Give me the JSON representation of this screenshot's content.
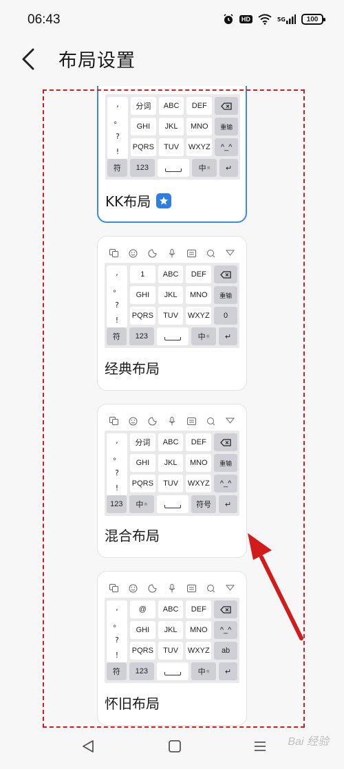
{
  "status": {
    "time": "06:43",
    "network": "5G",
    "battery": "100"
  },
  "header": {
    "title": "布局设置"
  },
  "layouts": [
    {
      "name": "KK布局",
      "selected": true,
      "rows": [
        [
          "分词",
          "ABC",
          "DEF",
          "⌫"
        ],
        [
          "GHI",
          "JKL",
          "MNO",
          "重输"
        ],
        [
          "PQRS",
          "TUV",
          "WXYZ",
          "^_^"
        ],
        [
          "符",
          "123",
          "",
          "中",
          "↵"
        ]
      ],
      "punct": [
        ",",
        "。",
        "?",
        "!"
      ]
    },
    {
      "name": "经典布局",
      "selected": false,
      "rows": [
        [
          "1",
          "ABC",
          "DEF",
          "⌫"
        ],
        [
          "GHI",
          "JKL",
          "MNO",
          "重输"
        ],
        [
          "PQRS",
          "TUV",
          "WXYZ",
          "0"
        ],
        [
          "符",
          "123",
          "",
          "中",
          "↵"
        ]
      ],
      "punct": [
        ",",
        "。",
        "?",
        "!"
      ]
    },
    {
      "name": "混合布局",
      "selected": false,
      "rows": [
        [
          "分词",
          "ABC",
          "DEF",
          "⌫"
        ],
        [
          "GHI",
          "JKL",
          "MNO",
          "重输"
        ],
        [
          "PQRS",
          "TUV",
          "WXYZ",
          "^_^"
        ],
        [
          "123",
          "中",
          "",
          "符号",
          "↵"
        ]
      ],
      "punct": [
        ",",
        "。",
        "?",
        "!"
      ]
    },
    {
      "name": "怀旧布局",
      "selected": false,
      "rows": [
        [
          "@",
          "ABC",
          "DEF",
          "⌫"
        ],
        [
          "GHI",
          "JKL",
          "MNO",
          "^_^"
        ],
        [
          "PQRS",
          "TUV",
          "WXYZ",
          "ab"
        ],
        [
          "符",
          "123",
          "",
          "中",
          "↵"
        ]
      ],
      "punct": [
        ",",
        "。",
        "?",
        "!"
      ]
    }
  ],
  "icons": {
    "back": "chevron-left-icon",
    "toolbar": [
      "translate-icon",
      "emoji-icon",
      "theme-icon",
      "mic-icon",
      "keyboard-icon",
      "search-icon",
      "collapse-icon"
    ],
    "nav": [
      "back-triangle-icon",
      "home-square-icon",
      "menu-lines-icon"
    ]
  },
  "colors": {
    "accent": "#2d7fe3",
    "annotation": "#d21b1b",
    "keyDark": "#cfd0d6"
  },
  "watermark": "Bai 经验"
}
